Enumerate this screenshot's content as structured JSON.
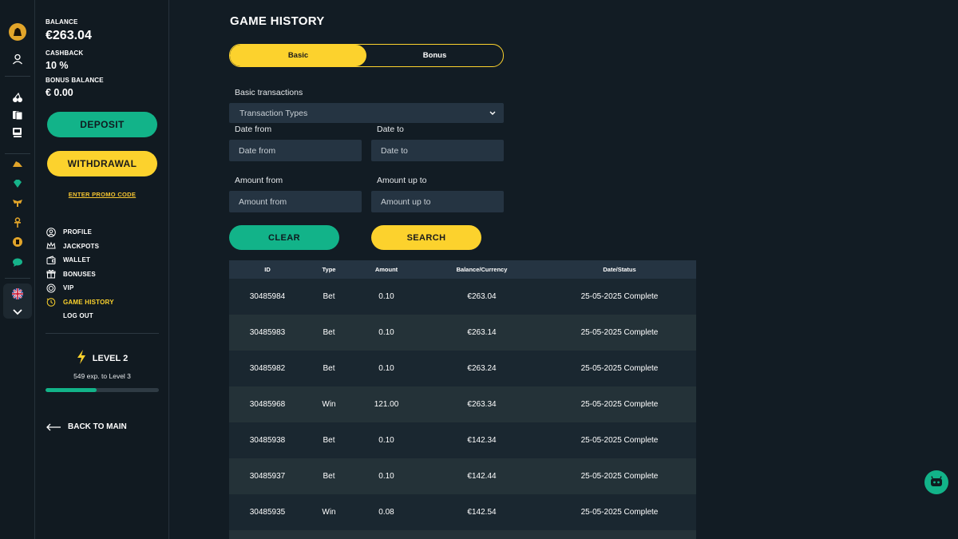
{
  "sidebar": {
    "balance_label": "BALANCE",
    "balance_value": "€263.04",
    "cashback_label": "CASHBACK",
    "cashback_value": "10 %",
    "bonus_label": "BONUS BALANCE",
    "bonus_value": "€ 0.00",
    "deposit_label": "DEPOSIT",
    "withdrawal_label": "WITHDRAWAL",
    "promo_label": "ENTER PROMO CODE",
    "menu": [
      {
        "label": "PROFILE",
        "icon": "profile-icon"
      },
      {
        "label": "JACKPOTS",
        "icon": "crown-icon"
      },
      {
        "label": "WALLET",
        "icon": "wallet-icon"
      },
      {
        "label": "BONUSES",
        "icon": "gift-icon"
      },
      {
        "label": "VIP",
        "icon": "vip-icon"
      },
      {
        "label": "GAME HISTORY",
        "icon": "history-icon"
      },
      {
        "label": "LOG OUT",
        "icon": "logout-icon"
      }
    ],
    "level_label": "LEVEL 2",
    "exp_label": "549 exp. to Level 3",
    "exp_progress": 0.45,
    "back_label": "BACK TO MAIN"
  },
  "main": {
    "title": "GAME HISTORY",
    "tabs": [
      "Basic",
      "Bonus"
    ],
    "section_label": "Basic transactions",
    "transaction_type_value": "Transaction Types",
    "date_from_label": "Date from",
    "date_from_placeholder": "Date from",
    "date_to_label": "Date to",
    "date_to_placeholder": "Date to",
    "amount_from_label": "Amount from",
    "amount_from_placeholder": "Amount from",
    "amount_to_label": "Amount up to",
    "amount_to_placeholder": "Amount up to",
    "clear_label": "CLEAR",
    "search_label": "SEARCH"
  },
  "table": {
    "headers": [
      "ID",
      "Type",
      "Amount",
      "Balance/Currency",
      "Date/Status"
    ],
    "rows": [
      [
        "30485984",
        "Bet",
        "0.10",
        "€263.04",
        "25-05-2025 Complete"
      ],
      [
        "30485983",
        "Bet",
        "0.10",
        "€263.14",
        "25-05-2025 Complete"
      ],
      [
        "30485982",
        "Bet",
        "0.10",
        "€263.24",
        "25-05-2025 Complete"
      ],
      [
        "30485968",
        "Win",
        "121.00",
        "€263.34",
        "25-05-2025 Complete"
      ],
      [
        "30485938",
        "Bet",
        "0.10",
        "€142.34",
        "25-05-2025 Complete"
      ],
      [
        "30485937",
        "Bet",
        "0.10",
        "€142.44",
        "25-05-2025 Complete"
      ],
      [
        "30485935",
        "Win",
        "0.08",
        "€142.54",
        "25-05-2025 Complete"
      ]
    ]
  },
  "colors": {
    "accent_green": "#12b389",
    "accent_yellow": "#fcd22d",
    "background": "#121c24"
  }
}
